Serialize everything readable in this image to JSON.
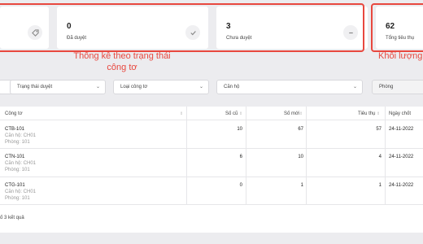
{
  "stats": [
    {
      "value": "",
      "label": "",
      "icon": "tag-icon"
    },
    {
      "value": "0",
      "label": "Đã duyệt",
      "icon": "check-icon"
    },
    {
      "value": "3",
      "label": "Chưa duyệt",
      "icon": "minus-icon"
    },
    {
      "value": "62",
      "label": "Tổng tiêu thụ",
      "icon": ""
    }
  ],
  "annotations": {
    "left_line1": "Thống kê theo trạng thái",
    "left_line2": "công tơ",
    "right": "Khối lượng"
  },
  "filters": {
    "f1": "",
    "f2": "Trạng thái duyệt",
    "f3": "Loại công tơ",
    "f4": "Căn hộ",
    "f5": "Phòng"
  },
  "table": {
    "headers": {
      "meter": "Công tơ",
      "old": "Số cũ",
      "new": "Số mới",
      "usage": "Tiêu thụ",
      "date": "Ngày chốt"
    },
    "rows": [
      {
        "meter": "CTB-101",
        "apartment": "Căn hộ: CH01",
        "room": "Phòng: 101",
        "old": "10",
        "new": "67",
        "usage": "57",
        "date": "24-11-2022"
      },
      {
        "meter": "CTN-101",
        "apartment": "Căn hộ: CH01",
        "room": "Phòng: 101",
        "old": "6",
        "new": "10",
        "usage": "4",
        "date": "24-11-2022"
      },
      {
        "meter": "CTG-101",
        "apartment": "Căn hộ: CH01",
        "room": "Phòng: 101",
        "old": "0",
        "new": "1",
        "usage": "1",
        "date": "24-11-2022"
      }
    ],
    "footer": "ố 3 kết quả"
  },
  "colors": {
    "highlight": "#e8483f"
  }
}
